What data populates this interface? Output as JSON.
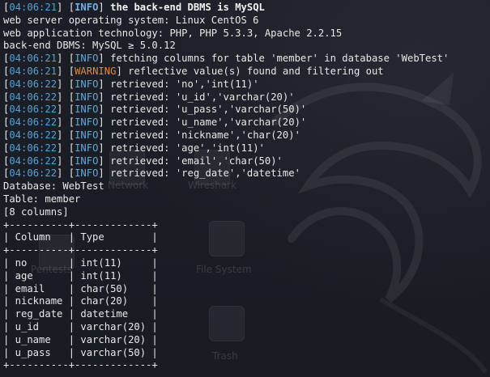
{
  "desktop": {
    "icon_labels": [
      "Network",
      "Wireshark",
      "File System",
      "Trash",
      "Pentests"
    ]
  },
  "terminal": {
    "lines": [
      {
        "ts": "04:06:21",
        "tag": "INFO",
        "tag_style": "bold",
        "text": " the back-end DBMS is MySQL",
        "text_style": "bold"
      },
      {
        "plain": "web server operating system: Linux CentOS 6"
      },
      {
        "plain": "web application technology: PHP, PHP 5.3.3, Apache 2.2.15"
      },
      {
        "plain": "back-end DBMS: MySQL ≥ 5.0.12"
      },
      {
        "ts": "04:06:21",
        "tag": "INFO",
        "text": " fetching columns for table 'member' in database 'WebTest'"
      },
      {
        "ts": "04:06:21",
        "tag": "WARNING",
        "text": " reflective value(s) found and filtering out"
      },
      {
        "ts": "04:06:22",
        "tag": "INFO",
        "text": " retrieved: 'no','int(11)'"
      },
      {
        "ts": "04:06:22",
        "tag": "INFO",
        "text": " retrieved: 'u_id','varchar(20)'"
      },
      {
        "ts": "04:06:22",
        "tag": "INFO",
        "text": " retrieved: 'u_pass','varchar(50)'"
      },
      {
        "ts": "04:06:22",
        "tag": "INFO",
        "text": " retrieved: 'u_name','varchar(20)'"
      },
      {
        "ts": "04:06:22",
        "tag": "INFO",
        "text": " retrieved: 'nickname','char(20)'"
      },
      {
        "ts": "04:06:22",
        "tag": "INFO",
        "text": " retrieved: 'age','int(11)'"
      },
      {
        "ts": "04:06:22",
        "tag": "INFO",
        "text": " retrieved: 'email','char(50)'"
      },
      {
        "ts": "04:06:22",
        "tag": "INFO",
        "text": " retrieved: 'reg_date','datetime'"
      },
      {
        "plain": "Database: WebTest"
      },
      {
        "plain": "Table: member"
      },
      {
        "plain": "[8 columns]"
      },
      {
        "plain": "+----------+-------------+"
      },
      {
        "plain": "| Column   | Type        |"
      },
      {
        "plain": "+----------+-------------+"
      },
      {
        "plain": "| no       | int(11)     |"
      },
      {
        "plain": "| age      | int(11)     |"
      },
      {
        "plain": "| email    | char(50)    |"
      },
      {
        "plain": "| nickname | char(20)    |"
      },
      {
        "plain": "| reg_date | datetime    |"
      },
      {
        "plain": "| u_id     | varchar(20) |"
      },
      {
        "plain": "| u_name   | varchar(20) |"
      },
      {
        "plain": "| u_pass   | varchar(50) |"
      },
      {
        "plain": "+----------+-------------+"
      }
    ]
  },
  "colors": {
    "background": "#1b1d26",
    "timestamp": "#4fa3d8",
    "info": "#5fa8d6",
    "warning": "#e08a3c",
    "text": "#e8e8e8"
  }
}
